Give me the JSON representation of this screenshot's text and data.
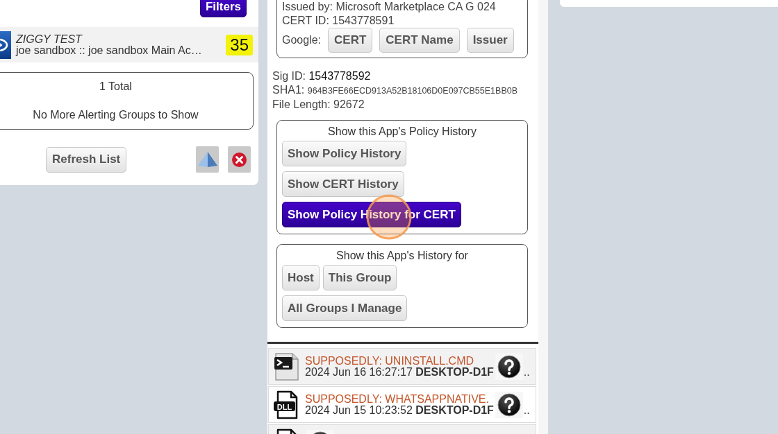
{
  "left_panel": {
    "filters_button": {
      "label": "Filters",
      "highlighted": true
    },
    "alert_groups": [
      {
        "name": "ZIGGY TEST",
        "path": "joe sandbox :: joe sandbox Main Ac…",
        "count": "35"
      }
    ],
    "summary": {
      "total": "1 Total",
      "message": "No More Alerting Groups to Show"
    },
    "refresh_button": "Refresh List"
  },
  "app_details": {
    "cert": {
      "issued_by": "Issued by: Microsoft Marketplace CA G 024",
      "cert_id": "CERT ID: 1543778591",
      "google_label": "Google:",
      "google_buttons": [
        "CERT",
        "CERT Name",
        "Issuer"
      ]
    },
    "fields": [
      {
        "kind": "emphasized",
        "label": "Sig ID:",
        "value": "1543778592"
      },
      {
        "kind": "hash",
        "label": "SHA1:",
        "value": "964B3FE66ECD913A52B18106D0E097CB55E1BB0B"
      },
      {
        "kind": "plain",
        "label": "File Length:",
        "value": "92672"
      }
    ],
    "policy_history": {
      "title": "Show this App's Policy History",
      "buttons": [
        {
          "label": "Show Policy History",
          "selected": false
        },
        {
          "label": "Show CERT History",
          "selected": false
        },
        {
          "label": "Show Policy History for CERT",
          "selected": true
        }
      ]
    },
    "history_for": {
      "title": "Show this App's History for",
      "buttons": [
        {
          "label": "Host",
          "selected": false
        },
        {
          "label": "This Group",
          "selected": false
        },
        {
          "label": "All Groups I Manage",
          "selected": false
        }
      ]
    }
  },
  "events": [
    {
      "kind": "script",
      "title": "SUPPOSEDLY: UNINSTALL.CMD",
      "detail": "2024 Jun 16 16:27:17 **DESKTOP-D1F**",
      "more": ".."
    },
    {
      "kind": "dll",
      "icon_label": "DLL",
      "title": "SUPPOSEDLY: WHATSAPPNATIVE.",
      "detail": "2024 Jun 15 10:23:52 **DESKTOP-D1F**",
      "more": ".."
    },
    {
      "kind": "file"
    }
  ]
}
